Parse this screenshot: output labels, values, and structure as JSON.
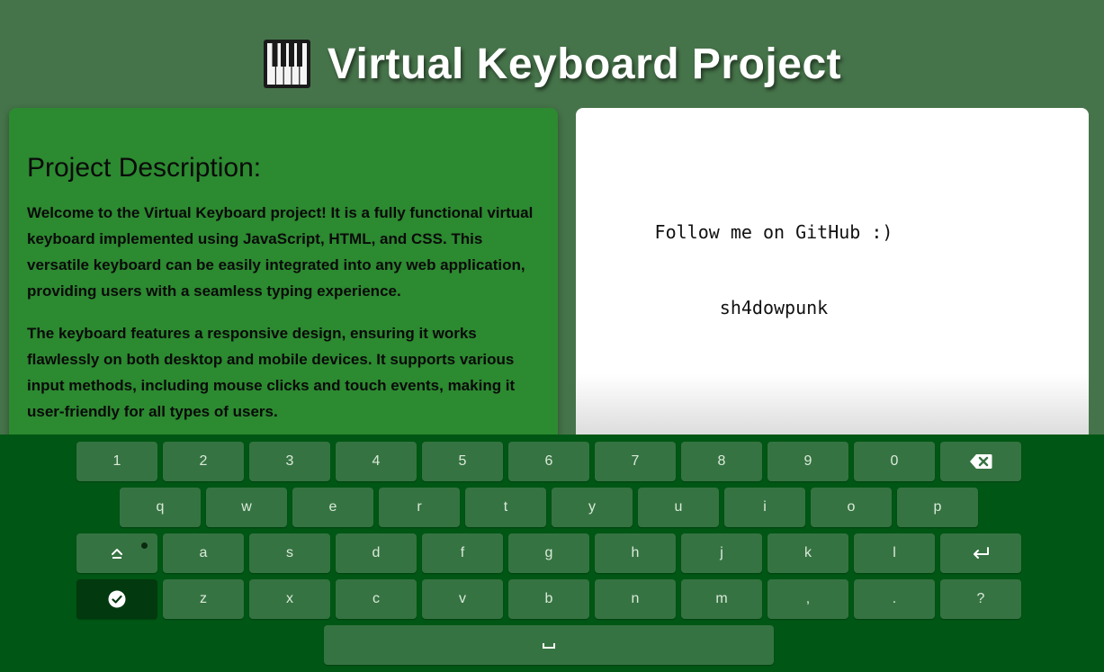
{
  "header": {
    "title": "Virtual Keyboard Project",
    "icon": "piano-icon"
  },
  "description": {
    "heading": "Project Description:",
    "paragraphs": [
      "Welcome to the Virtual Keyboard project! It is a fully functional virtual keyboard implemented using JavaScript, HTML, and CSS. This versatile keyboard can be easily integrated into any web application, providing users with a seamless typing experience.",
      "The keyboard features a responsive design, ensuring it works flawlessly on both desktop and mobile devices. It supports various input methods, including mouse clicks and touch events, making it user-friendly for all types of users."
    ]
  },
  "textarea": {
    "lines": [
      "Follow me on GitHub :)",
      "sh4dowpunk"
    ]
  },
  "keyboard": {
    "row1": [
      "1",
      "2",
      "3",
      "4",
      "5",
      "6",
      "7",
      "8",
      "9",
      "0"
    ],
    "row2": [
      "q",
      "w",
      "e",
      "r",
      "t",
      "y",
      "u",
      "i",
      "o",
      "p"
    ],
    "row3": [
      "a",
      "s",
      "d",
      "f",
      "g",
      "h",
      "j",
      "k",
      "l"
    ],
    "row4": [
      "z",
      "x",
      "c",
      "v",
      "b",
      "n",
      "m",
      ",",
      ".",
      "?"
    ],
    "icons": {
      "backspace": "backspace-icon",
      "caps": "caps-lock-icon",
      "enter": "enter-icon",
      "done": "checkmark-icon",
      "space": "space-icon"
    }
  },
  "colors": {
    "page_bg": "#46744a",
    "panel_green": "#2c8a30",
    "keyboard_bg": "#005614",
    "key_bg": "#367342",
    "key_done_bg": "#03390e"
  }
}
